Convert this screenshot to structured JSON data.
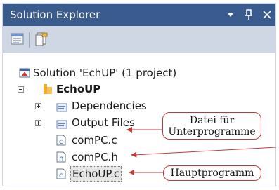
{
  "panel": {
    "title": "Solution Explorer",
    "controls": [
      "dropdown-arrow",
      "pin",
      "close"
    ]
  },
  "toolbar": {
    "buttons": [
      {
        "icon": "properties-icon"
      },
      {
        "icon": "show-all-files-icon"
      }
    ]
  },
  "tree": {
    "solution": {
      "label": "Solution 'EchUP' (1 project)",
      "icon": "solution-icon"
    },
    "project": {
      "label": "EchoUP",
      "icon": "project-icon",
      "expanded": true
    },
    "items": [
      {
        "label": "Dependencies",
        "icon": "folder-icon",
        "expandable": true
      },
      {
        "label": "Output Files",
        "icon": "folder-icon",
        "expandable": true
      },
      {
        "label": "comPC.c",
        "icon": "c-file-icon"
      },
      {
        "label": "comPC.h",
        "icon": "h-file-icon"
      },
      {
        "label": "EchoUP.c",
        "icon": "c-file-icon",
        "selected": true
      }
    ]
  },
  "annotations": {
    "datei": {
      "line1": "Datei für",
      "line2": "Unterprogramme"
    },
    "haupt": {
      "text": "Hauptprogramm"
    }
  },
  "colors": {
    "titlebar": "#3a5b8d",
    "toolbar": "#cfd7e4",
    "annotation": "#c23b3b",
    "selection": "#e6e6e6"
  }
}
